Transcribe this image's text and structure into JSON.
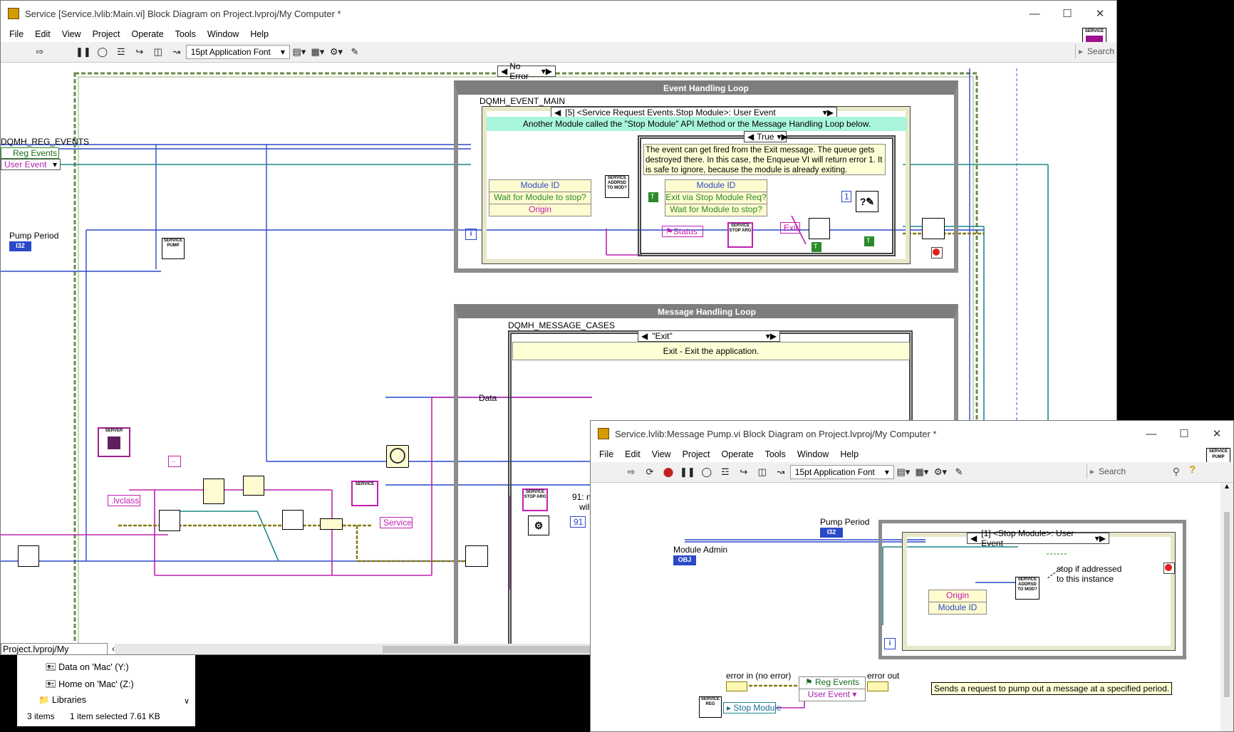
{
  "main_window": {
    "title": "Service [Service.lvlib:Main.vi] Block Diagram on Project.lvproj/My Computer *",
    "menu": [
      "File",
      "Edit",
      "View",
      "Project",
      "Operate",
      "Tools",
      "Window",
      "Help"
    ],
    "font_selector": "15pt Application Font",
    "search_placeholder": "Search",
    "corner_icon": "SERVICE",
    "error_case": "No Error",
    "event_loop": {
      "title": "Event Handling Loop",
      "structure_label": "DQMH_EVENT_MAIN",
      "event_case": "[5] <Service Request Events.Stop Module>: User Event",
      "event_comment": "Another Module called the \"Stop Module\" API Method  or the Message Handling Loop below.",
      "true_case": "True",
      "note": "The event can get fired from the Exit message. The queue gets destroyed there. In this case, the Enqueue VI will return error 1. It is safe to ignore, because the module is already exiting.",
      "unbundle_left": [
        "Module ID",
        "Wait for Module to stop?",
        "Origin"
      ],
      "unbundle_right": [
        "Module ID",
        "Exit via Stop Module Req?",
        "Wait for Module to stop?"
      ],
      "status_const": "Status",
      "exit_const": "Exit",
      "const_one": "1",
      "addressed_vi": "SERVICE ADDRSD TO MOD?",
      "stop_arg_vi": "SERVICE STOP ARG",
      "bool_true": "T"
    },
    "left_labels": {
      "reg_events_label": "DQMH_REG_EVENTS",
      "reg_events": "Reg Events",
      "user_event": "User Event",
      "pump_period": "Pump Period",
      "i32": "I32",
      "pump_vi": "SERVICE PUMP",
      "server_vi": "SERVER",
      "lvclass_const": ".lvclass",
      "service_const": "Service",
      "path_const": ".."
    },
    "message_loop": {
      "title": "Message Handling Loop",
      "structure_label": "DQMH_MESSAGE_CASES",
      "case": "\"Exit\"",
      "comment": "Exit - Exit the application.",
      "data_label": "Data",
      "stop_arg_vi": "SERVICE STOP ARG",
      "const_91": "91",
      "partial_text_1": "91: n",
      "partial_text_2": "will"
    }
  },
  "explorer_strip": {
    "path": "Project.lvproj/My Computer",
    "items": [
      "Data on 'Mac' (Y:)",
      "Home on 'Mac' (Z:)",
      "Libraries"
    ],
    "status_items": "3 items",
    "status_selected": "1 item selected  7.61 KB"
  },
  "second_window": {
    "title": "Service.lvlib:Message Pump.vi Block Diagram on Project.lvproj/My Computer *",
    "menu": [
      "File",
      "Edit",
      "View",
      "Project",
      "Operate",
      "Tools",
      "Window",
      "Help"
    ],
    "font_selector": "15pt Application Font",
    "search_placeholder": "Search",
    "corner_icon": "SERVICE PUMP",
    "pump_period": "Pump Period",
    "i32": "I32",
    "module_admin": "Module Admin",
    "obj": "OBJ",
    "event_case": "[1] <Stop Module>: User Event",
    "origin": "Origin",
    "module_id": "Module ID",
    "addressed_vi": "SERVICE ADDRSD TO MOD?",
    "stop_comment": "stop if addressed to this instance",
    "error_in": "error in (no error)",
    "error_out": "error out",
    "reg_events": "Reg Events",
    "user_event": "User Event",
    "stop_module": "Stop Module",
    "reg_vi": "SERVICE REG",
    "description": "Sends a request to pump out a message at a specified period."
  }
}
